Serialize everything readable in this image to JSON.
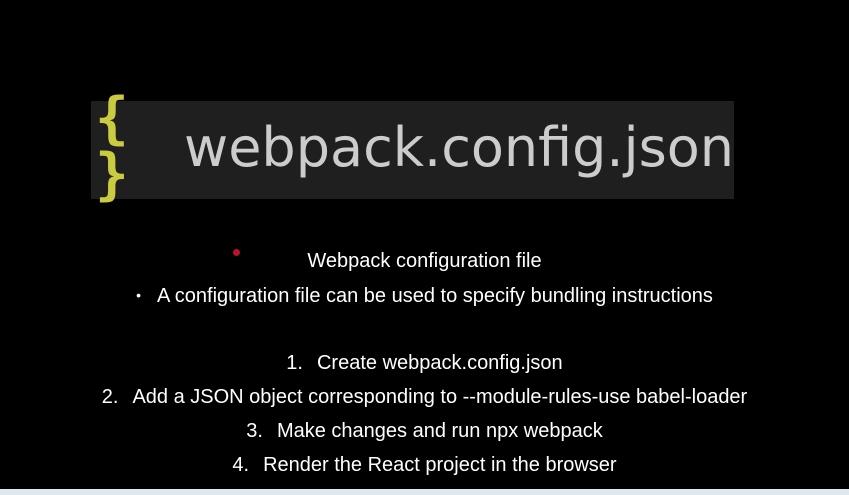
{
  "banner": {
    "icon": "braces-icon",
    "braces_text": "{ }",
    "filename": "webpack.config.json"
  },
  "heading": "Webpack configuration file",
  "bullet": {
    "marker": "•",
    "text": "A configuration file can be used to specify bundling instructions"
  },
  "steps": [
    {
      "marker": "1.",
      "text": "Create webpack.config.json"
    },
    {
      "marker": "2.",
      "text": "Add a JSON object corresponding to --module-rules-use babel-loader"
    },
    {
      "marker": "3.",
      "text": "Make changes and run npx webpack"
    },
    {
      "marker": "4.",
      "text": "Render the React project in the browser"
    }
  ],
  "colors": {
    "background": "#000000",
    "banner_bg": "#1f1f1f",
    "braces": "#cbcb41",
    "filename": "#cccccc",
    "dot": "#c0102a"
  }
}
